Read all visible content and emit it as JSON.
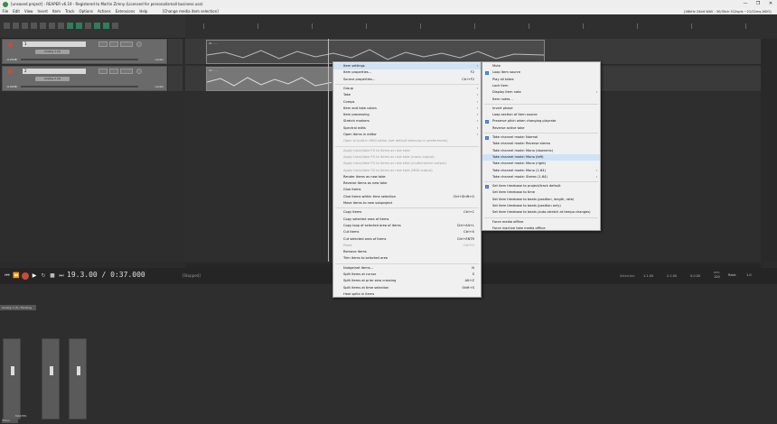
{
  "window": {
    "title": "[unsaved project] - REAPER v6.19 - Registered to Martin Zimny (Licensed for personal/small business use)",
    "controls": [
      "—",
      "❐",
      "✕"
    ]
  },
  "menubar": {
    "items": [
      "File",
      "Edit",
      "View",
      "Insert",
      "Item",
      "Track",
      "Options",
      "Actions",
      "Extensions",
      "Help"
    ],
    "status": "[Change media item selection]",
    "audio_info": "[48kHz 24bit WAV : 30/30ch 512spls ~21/22ms ASIO]"
  },
  "tracks": [
    {
      "number": "1",
      "fx_label": "Analog 1 (2)",
      "volume": "-0.00dB",
      "routing": "center"
    },
    {
      "number": "2",
      "fx_label": "Analog 2 (2)",
      "volume": "-0.00dB",
      "routing": "center"
    }
  ],
  "items": [
    {
      "name": "01 - ..."
    },
    {
      "name": "02 - ..."
    }
  ],
  "transport": {
    "time": "19.3.00 / 0:37.000",
    "status": "[Stopped]",
    "selection_label": "Selection:",
    "sel_start": "1.1.00",
    "sel_end": "2.1.00",
    "sel_length": "0.0.00",
    "bpm_label": "BPM",
    "bpm": "120",
    "rate_label": "Rate:",
    "rate": "1.0"
  },
  "mixer": {
    "routing_tab": "Analog 1 (2) / Routing",
    "master_label": "MASTER",
    "mixer_tab": "Mixer"
  },
  "context_menu": {
    "items": [
      {
        "label": "Item settings",
        "shortcut": "",
        "submenu": true,
        "highlight": true
      },
      {
        "label": "Item properties...",
        "shortcut": "F2"
      },
      {
        "label": "Source properties...",
        "shortcut": "Ctrl+F2"
      },
      {
        "sep": true
      },
      {
        "label": "Group",
        "submenu": true
      },
      {
        "label": "Take",
        "submenu": true
      },
      {
        "label": "Comps",
        "submenu": true
      },
      {
        "label": "Item and take colors",
        "submenu": true
      },
      {
        "label": "Item processing",
        "submenu": true
      },
      {
        "label": "Stretch markers",
        "submenu": true
      },
      {
        "label": "Spectral edits",
        "submenu": true
      },
      {
        "label": "Open items in editor",
        "submenu": true
      },
      {
        "label": "Open in built-in MIDI editor (set default behavior in preferences)",
        "disabled": true
      },
      {
        "sep": true
      },
      {
        "label": "Apply track/take FX to items as new take",
        "disabled": true
      },
      {
        "label": "Apply track/take FX to items as new take (mono output)",
        "disabled": true
      },
      {
        "label": "Apply track/take FX to items as new take (multichannel output)",
        "disabled": true
      },
      {
        "label": "Apply track/take FX to items as new take (MIDI output)",
        "disabled": true
      },
      {
        "label": "Render items as new take"
      },
      {
        "label": "Reverse items as new take"
      },
      {
        "label": "Glue items"
      },
      {
        "label": "Glue items within time selection",
        "shortcut": "Ctrl+Shift+G"
      },
      {
        "label": "Move items to new subproject"
      },
      {
        "sep": true
      },
      {
        "label": "Copy items",
        "shortcut": "Ctrl+C"
      },
      {
        "label": "Copy selected area of items"
      },
      {
        "label": "Copy loop of selected area of items",
        "shortcut": "Ctrl+Alt+L"
      },
      {
        "label": "Cut items",
        "shortcut": "Ctrl+X"
      },
      {
        "label": "Cut selected area of items",
        "shortcut": "Ctrl+ENTR"
      },
      {
        "label": "Paste",
        "shortcut": "Ctrl+V",
        "disabled": true
      },
      {
        "label": "Remove items"
      },
      {
        "label": "Trim items to selected area"
      },
      {
        "sep": true
      },
      {
        "label": "Nudge/set items...",
        "shortcut": "N"
      },
      {
        "label": "Split items at cursor",
        "shortcut": "S"
      },
      {
        "label": "Split items at prior zero crossing",
        "shortcut": "Alt+Z"
      },
      {
        "label": "Split items at time selection",
        "shortcut": "Shift+S"
      },
      {
        "label": "Heal splits in items"
      }
    ],
    "submenu": [
      {
        "label": "Mute"
      },
      {
        "label": "Loop item source",
        "checked": true
      },
      {
        "label": "Play all takes"
      },
      {
        "label": "Lock item"
      },
      {
        "label": "Display item note",
        "submenu": true
      },
      {
        "label": "Item notes..."
      },
      {
        "sep": true
      },
      {
        "label": "Invert phase"
      },
      {
        "label": "Loop section of item source"
      },
      {
        "label": "Preserve pitch when changing playrate",
        "checked": true
      },
      {
        "label": "Reverse active take"
      },
      {
        "sep": true
      },
      {
        "label": "Take channel mode: Normal",
        "checked": true
      },
      {
        "label": "Take channel mode: Reverse stereo"
      },
      {
        "label": "Take channel mode: Mono (downmix)"
      },
      {
        "label": "Take channel mode: Mono (left)",
        "highlight": true
      },
      {
        "label": "Take channel mode: Mono (right)"
      },
      {
        "label": "Take channel mode: Mono (1-64)",
        "submenu": true
      },
      {
        "label": "Take channel mode: Stereo (1-64)",
        "submenu": true
      },
      {
        "sep": true
      },
      {
        "label": "Set item timebase to project/track default",
        "checked": true
      },
      {
        "label": "Set item timebase to time"
      },
      {
        "label": "Set item timebase to beats (position, length, rate)"
      },
      {
        "label": "Set item timebase to beats (position only)"
      },
      {
        "label": "Set item timebase to beats (auto-stretch at tempo changes)"
      },
      {
        "sep": true
      },
      {
        "label": "Force media offline"
      },
      {
        "label": "Force inactive take media offline"
      }
    ]
  }
}
